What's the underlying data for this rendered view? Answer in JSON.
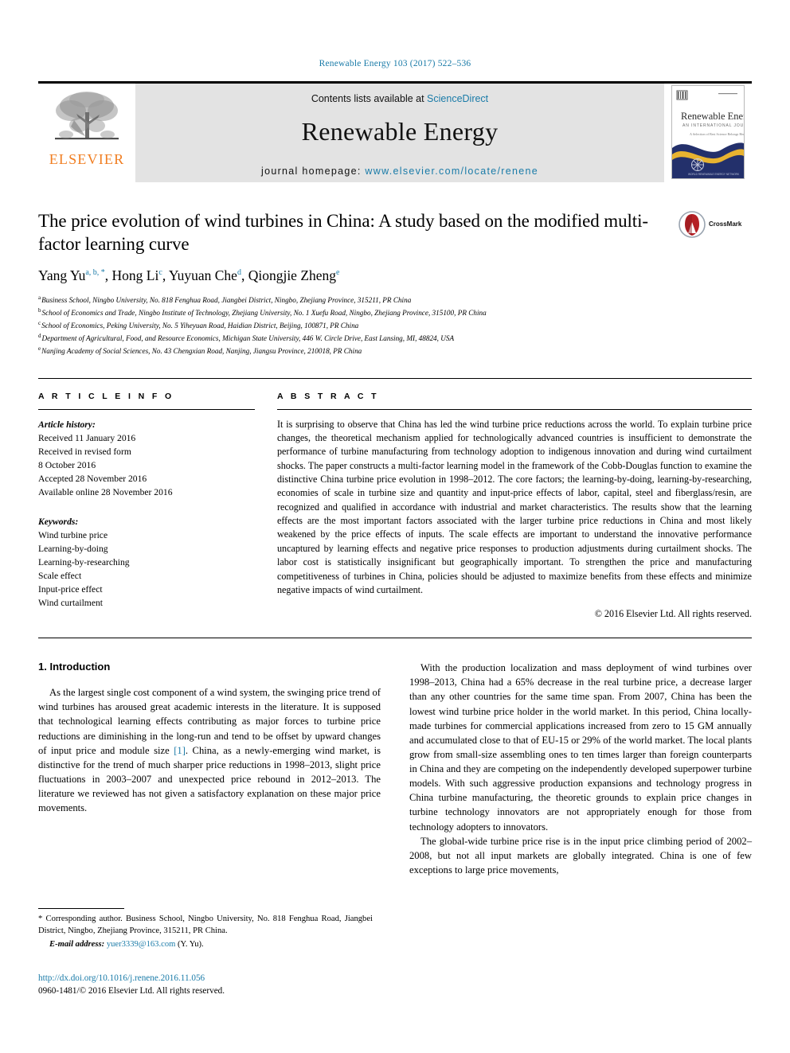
{
  "running_head": "Renewable Energy 103 (2017) 522–536",
  "masthead": {
    "publisher_name": "ELSEVIER",
    "contents_prefix": "Contents lists available at ",
    "contents_link": "ScienceDirect",
    "journal_name": "Renewable Energy",
    "homepage_prefix": "journal homepage: ",
    "homepage_url": "www.elsevier.com/locate/renene",
    "cover_title": "Renewable Energy",
    "cover_subtitle": "AN INTERNATIONAL JOURNAL",
    "cover_tagline": "A Selection of Best Science Belongs Here"
  },
  "article": {
    "title": "The price evolution of wind turbines in China: A study based on the modified multi-factor learning curve",
    "crossmark_label": "CrossMark",
    "authors": [
      {
        "name": "Yang Yu",
        "marks": "a, b, *"
      },
      {
        "name": "Hong Li",
        "marks": "c"
      },
      {
        "name": "Yuyuan Che",
        "marks": "d"
      },
      {
        "name": "Qiongjie Zheng",
        "marks": "e"
      }
    ],
    "affiliations": [
      {
        "mark": "a",
        "text": "Business School, Ningbo University, No. 818 Fenghua Road, Jiangbei District, Ningbo, Zhejiang Province, 315211, PR China"
      },
      {
        "mark": "b",
        "text": "School of Economics and Trade, Ningbo Institute of Technology, Zhejiang University, No. 1 Xuefu Road, Ningbo, Zhejiang Province, 315100, PR China"
      },
      {
        "mark": "c",
        "text": "School of Economics, Peking University, No. 5 Yiheyuan Road, Haidian District, Beijing, 100871, PR China"
      },
      {
        "mark": "d",
        "text": "Department of Agricultural, Food, and Resource Economics, Michigan State University, 446 W. Circle Drive, East Lansing, MI, 48824, USA"
      },
      {
        "mark": "e",
        "text": "Nanjing Academy of Social Sciences, No. 43 Chengxian Road, Nanjing, Jiangsu Province, 210018, PR China"
      }
    ]
  },
  "article_info": {
    "heading": "A R T I C L E   I N F O",
    "history_label": "Article history:",
    "history_lines": [
      "Received 11 January 2016",
      "Received in revised form",
      "8 October 2016",
      "Accepted 28 November 2016",
      "Available online 28 November 2016"
    ],
    "keywords_label": "Keywords:",
    "keywords": [
      "Wind turbine price",
      "Learning-by-doing",
      "Learning-by-researching",
      "Scale effect",
      "Input-price effect",
      "Wind curtailment"
    ]
  },
  "abstract": {
    "heading": "A B S T R A C T",
    "text": "It is surprising to observe that China has led the wind turbine price reductions across the world. To explain turbine price changes, the theoretical mechanism applied for technologically advanced countries is insufficient to demonstrate the performance of turbine manufacturing from technology adoption to indigenous innovation and during wind curtailment shocks. The paper constructs a multi-factor learning model in the framework of the Cobb-Douglas function to examine the distinctive China turbine price evolution in 1998–2012. The core factors; the learning-by-doing, learning-by-researching, economies of scale in turbine size and quantity and input-price effects of labor, capital, steel and fiberglass/resin, are recognized and qualified in accordance with industrial and market characteristics. The results show that the learning effects are the most important factors associated with the larger turbine price reductions in China and most likely weakened by the price effects of inputs. The scale effects are important to understand the innovative performance uncaptured by learning effects and negative price responses to production adjustments during curtailment shocks. The labor cost is statistically insignificant but geographically important. To strengthen the price and manufacturing competitiveness of turbines in China, policies should be adjusted to maximize benefits from these effects and minimize negative impacts of wind curtailment.",
    "copyright": "© 2016 Elsevier Ltd. All rights reserved."
  },
  "body": {
    "section_number_title": "1. Introduction",
    "left_paragraph_1_a": "As the largest single cost component of a wind system, the swinging price trend of wind turbines has aroused great academic interests in the literature. It is supposed that technological learning effects contributing as major forces to turbine price reductions are diminishing in the long-run and tend to be offset by upward changes of input price and module size ",
    "left_ref": "[1]",
    "left_paragraph_1_b": ". China, as a newly-emerging wind market, is distinctive for the trend of much sharper price reductions in 1998–2013, slight price fluctuations in 2003–2007 and unexpected price rebound in 2012–2013. The literature we reviewed has not given a satisfactory explanation on these major price movements.",
    "right_paragraph_1": "With the production localization and mass deployment of wind turbines over 1998–2013, China had a 65% decrease in the real turbine price, a decrease larger than any other countries for the same time span. From 2007, China has been the lowest wind turbine price holder in the world market. In this period, China locally-made turbines for commercial applications increased from zero to 15 GM annually and accumulated close to that of EU-15 or 29% of the world market. The local plants grow from small-size assembling ones to ten times larger than foreign counterparts in China and they are competing on the independently developed superpower turbine models. With such aggressive production expansions and technology progress in China turbine manufacturing, the theoretic grounds to explain price changes in turbine technology innovators are not appropriately enough for those from technology adopters to innovators.",
    "right_paragraph_2": "The global-wide turbine price rise is in the input price climbing period of 2002–2008, but not all input markets are globally integrated. China is one of few exceptions to large price movements,"
  },
  "footnote": {
    "corresponding_mark": "*",
    "corresponding_text": "Corresponding author. Business School, Ningbo University, No. 818 Fenghua Road, Jiangbei District, Ningbo, Zhejiang Province, 315211, PR China.",
    "email_label": "E-mail address:",
    "email": "yuer3339@163.com",
    "email_suffix": "(Y. Yu)."
  },
  "doi_block": {
    "doi": "http://dx.doi.org/10.1016/j.renene.2016.11.056",
    "issn": "0960-1481/© 2016 Elsevier Ltd. All rights reserved."
  },
  "colors": {
    "link_blue": "#1a7ba8",
    "elsevier_orange": "#f07d20",
    "band_gray": "#e3e3e3",
    "cover_navy": "#23306b",
    "cover_gold": "#e8b330",
    "crossmark_red": "#b52025"
  }
}
